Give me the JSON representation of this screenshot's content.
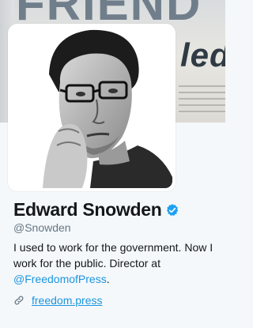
{
  "profile": {
    "name": "Edward Snowden",
    "handle": "@Snowden",
    "verified": true,
    "bio_text": "I used to work for the government. Now I work for the public. Director at",
    "bio_mention": "@FreedomofPress",
    "bio_end": ".",
    "website": "freedom.press"
  },
  "banner": {
    "headline": "FRIEND",
    "word": "led"
  },
  "icons": {
    "verified": "verified-badge-icon",
    "link": "link-icon"
  },
  "colors": {
    "background": "#f5f8fa",
    "link": "#1b95e0",
    "verified": "#1da1f2",
    "name": "#14171a",
    "handle": "#657786"
  }
}
